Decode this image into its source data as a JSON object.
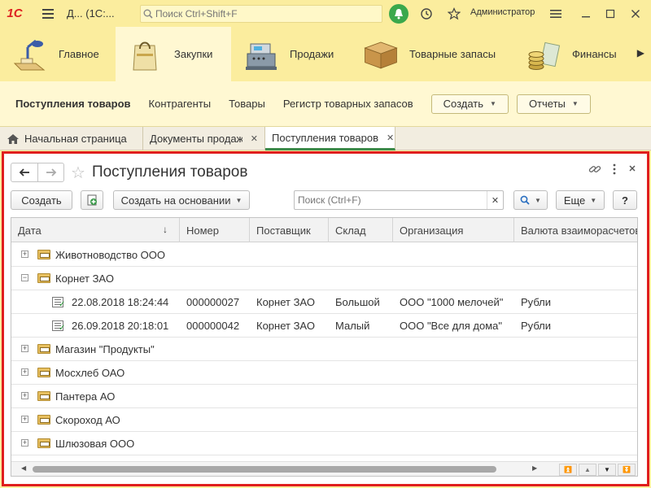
{
  "app": {
    "logo": "1С",
    "title": "Д... (1С:...",
    "search_placeholder": "Поиск Ctrl+Shift+F",
    "user": "Администратор"
  },
  "sections": [
    {
      "label": "Главное",
      "icon": "desk-lamp-icon"
    },
    {
      "label": "Закупки",
      "icon": "shopping-bag-icon"
    },
    {
      "label": "Продажи",
      "icon": "cash-register-icon"
    },
    {
      "label": "Товарные запасы",
      "icon": "box-icon"
    },
    {
      "label": "Финансы",
      "icon": "coins-icon"
    }
  ],
  "subnav": {
    "links": [
      "Поступления товаров",
      "Контрагенты",
      "Товары",
      "Регистр товарных запасов"
    ],
    "create_label": "Создать",
    "reports_label": "Отчеты"
  },
  "tabs": [
    {
      "label": "Начальная страница"
    },
    {
      "label": "Документы продаж"
    },
    {
      "label": "Поступления товаров"
    }
  ],
  "form": {
    "title": "Поступления товаров",
    "create_label": "Создать",
    "create_based_label": "Создать на основании",
    "search_placeholder": "Поиск (Ctrl+F)",
    "more_label": "Еще",
    "help_label": "?"
  },
  "columns": [
    "Дата",
    "Номер",
    "Поставщик",
    "Склад",
    "Организация",
    "Валюта взаиморасчетов"
  ],
  "sort_indicator": "↓",
  "rows": [
    {
      "type": "group",
      "expanded": false,
      "name": "Животноводство ООО"
    },
    {
      "type": "group",
      "expanded": true,
      "name": "Корнет ЗАО"
    },
    {
      "type": "doc",
      "date": "22.08.2018 18:24:44",
      "number": "000000027",
      "supplier": "Корнет ЗАО",
      "warehouse": "Большой",
      "org": "ООО \"1000 мелочей\"",
      "currency": "Рубли"
    },
    {
      "type": "doc",
      "date": "26.09.2018 20:18:01",
      "number": "000000042",
      "supplier": "Корнет ЗАО",
      "warehouse": "Малый",
      "org": "ООО \"Все для дома\"",
      "currency": "Рубли"
    },
    {
      "type": "group",
      "expanded": false,
      "name": "Магазин \"Продукты\""
    },
    {
      "type": "group",
      "expanded": false,
      "name": "Мосхлеб ОАО"
    },
    {
      "type": "group",
      "expanded": false,
      "name": "Пантера АО"
    },
    {
      "type": "group",
      "expanded": false,
      "name": "Скороход АО"
    },
    {
      "type": "group",
      "expanded": false,
      "name": "Шлюзовая ООО"
    }
  ],
  "colors": {
    "accent_yellow": "#fbed9e",
    "active_tab_green": "#3d8c4a",
    "highlight_border": "#e01e1e"
  }
}
